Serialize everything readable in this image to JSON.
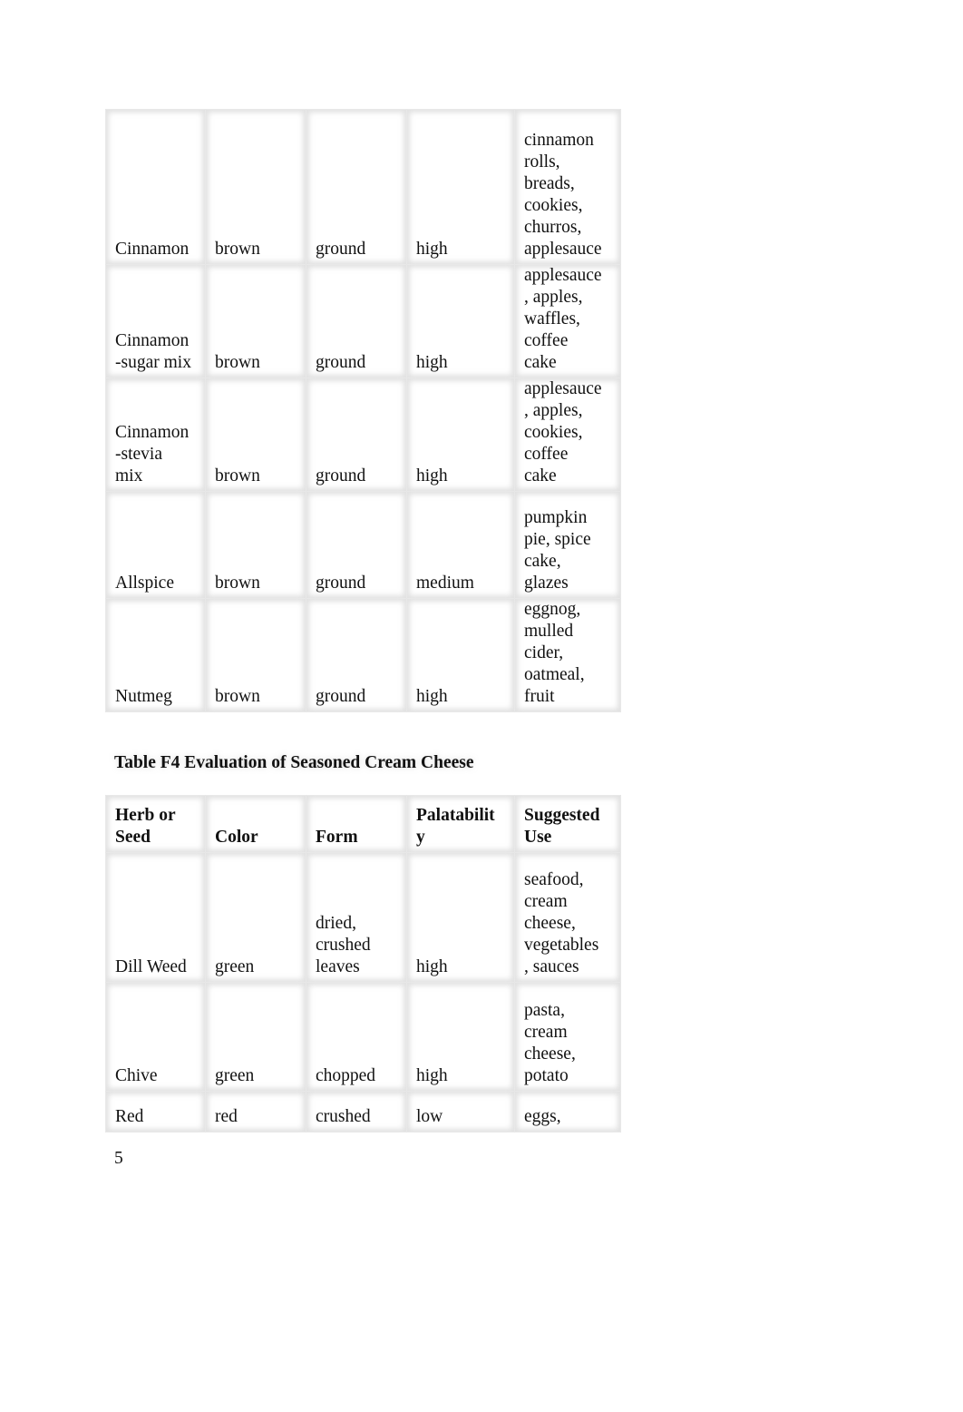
{
  "table_f3": {
    "rows": [
      [
        "Cinnamon",
        "brown",
        "ground",
        "high",
        "cinnamon\nrolls,\nbreads,\ncookies,\nchurros,\napplesauce"
      ],
      [
        "Cinnamon\n-sugar mix",
        "brown",
        "ground",
        "high",
        "applesauce\n, apples,\nwaffles,\ncoffee\ncake"
      ],
      [
        "Cinnamon\n-stevia\nmix",
        "brown",
        "ground",
        "high",
        "applesauce\n, apples,\ncookies,\ncoffee\ncake"
      ],
      [
        "Allspice",
        "brown",
        "ground",
        "medium",
        "pumpkin\npie, spice\ncake,\nglazes"
      ],
      [
        "Nutmeg",
        "brown",
        "ground",
        "high",
        "eggnog,\nmulled\ncider,\noatmeal,\nfruit"
      ]
    ]
  },
  "table_f4": {
    "caption": "Table F4 Evaluation of Seasoned Cream Cheese",
    "headers": [
      "Herb or\nSeed",
      "Color",
      "Form",
      "Palatabilit\ny",
      "Suggested\nUse"
    ],
    "rows": [
      [
        "Dill Weed",
        "green",
        "dried,\ncrushed\nleaves",
        "high",
        "seafood,\ncream\ncheese,\nvegetables\n, sauces"
      ],
      [
        "Chive",
        "green",
        "chopped",
        "high",
        "pasta,\ncream\ncheese,\npotato"
      ],
      [
        "Red",
        "red",
        "crushed",
        "low",
        "eggs,"
      ]
    ]
  },
  "page_number": "5"
}
